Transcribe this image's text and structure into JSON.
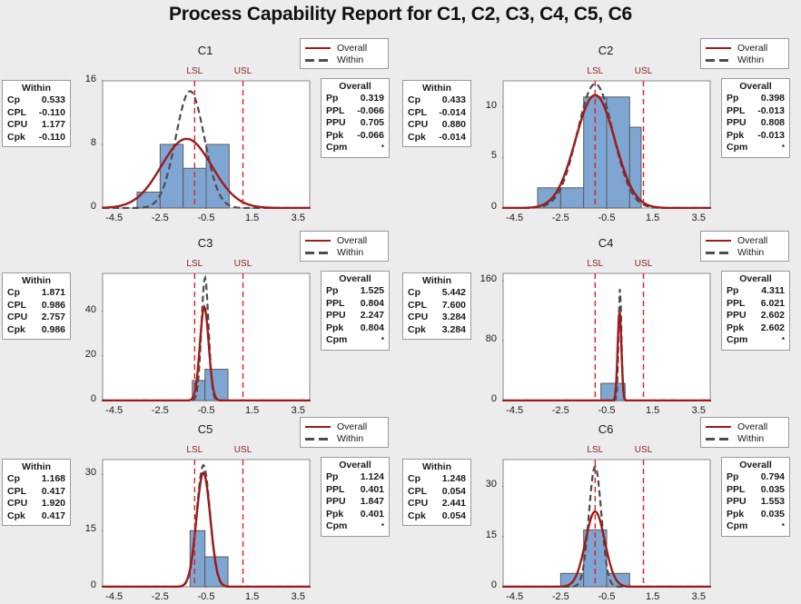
{
  "report": {
    "title": "Process Capability Report for C1, C2, C3, C4, C5, C6",
    "background_color": "#ececed",
    "bar_fill_color": "#7FA6D3",
    "bar_edge_color": "#5b5b5b",
    "overall_curve_color": "#9e1b1b",
    "within_curve_color": "#4d4d4d",
    "limit_line_color": "#e02020",
    "limit_label_color": "#8d2020"
  },
  "legend": {
    "overall_label": "Overall",
    "within_label": "Within",
    "overall_icon": "solid-line-icon",
    "within_icon": "dashed-line-icon"
  },
  "labels": {
    "lsl": "LSL",
    "usl": "USL",
    "within_header": "Within",
    "overall_header": "Overall",
    "within_keys": [
      "Cp",
      "CPL",
      "CPU",
      "Cpk"
    ],
    "overall_keys": [
      "Pp",
      "PPL",
      "PPU",
      "Ppk",
      "Cpm"
    ],
    "star": "*"
  },
  "chart_data": [
    {
      "type": "bar",
      "title": "C1",
      "xlabel": "",
      "ylabel": "",
      "xlim": [
        -5.0,
        4.0
      ],
      "ylim": [
        0,
        16
      ],
      "xticks": [
        -4.5,
        -2.5,
        -0.5,
        1.5,
        3.5
      ],
      "xticklabels": [
        "-4.5",
        "-2.5",
        "-0.5",
        "1.5",
        "3.5"
      ],
      "yticks": [
        0,
        8,
        16
      ],
      "yticklabels": [
        "0",
        "8",
        "16"
      ],
      "grid": false,
      "lsl": -1.0,
      "usl": 1.1,
      "bins": [
        {
          "left": -3.5,
          "right": -2.5,
          "count": 2
        },
        {
          "left": -2.5,
          "right": -1.5,
          "count": 8
        },
        {
          "left": -1.5,
          "right": -0.5,
          "count": 5
        },
        {
          "left": -0.5,
          "right": 0.5,
          "count": 8
        }
      ],
      "overall_curve": {
        "mean": -1.35,
        "sd": 1.1,
        "peak": 8.7
      },
      "within_curve": {
        "mean": -1.2,
        "sd": 0.62,
        "peak": 14.7
      },
      "within": {
        "Cp": "0.533",
        "CPL": "-0.110",
        "CPU": "1.177",
        "Cpk": "-0.110"
      },
      "overall": {
        "Pp": "0.319",
        "PPL": "-0.066",
        "PPU": "0.705",
        "Ppk": "-0.066",
        "Cpm": "*"
      }
    },
    {
      "type": "bar",
      "title": "C2",
      "xlabel": "",
      "ylabel": "",
      "xlim": [
        -5.0,
        4.0
      ],
      "ylim": [
        0,
        12.6
      ],
      "xticks": [
        -4.5,
        -2.5,
        -0.5,
        1.5,
        3.5
      ],
      "xticklabels": [
        "-4.5",
        "-2.5",
        "-0.5",
        "1.5",
        "3.5"
      ],
      "yticks": [
        0,
        5,
        10
      ],
      "yticklabels": [
        "0",
        "5",
        "10"
      ],
      "grid": false,
      "lsl": -1.0,
      "usl": 1.1,
      "bins": [
        {
          "left": -3.5,
          "right": -2.5,
          "count": 2
        },
        {
          "left": -2.5,
          "right": -1.5,
          "count": 2
        },
        {
          "left": -1.5,
          "right": -0.5,
          "count": 11
        },
        {
          "left": -0.5,
          "right": 0.5,
          "count": 11
        },
        {
          "left": 0.5,
          "right": 1.0,
          "count": 8
        }
      ],
      "overall_curve": {
        "mean": -1.0,
        "sd": 0.85,
        "peak": 11.2
      },
      "within_curve": {
        "mean": -1.0,
        "sd": 0.78,
        "peak": 12.3
      },
      "within": {
        "Cp": "0.433",
        "CPL": "-0.014",
        "CPU": "0.880",
        "Cpk": "-0.014"
      },
      "overall": {
        "Pp": "0.398",
        "PPL": "-0.013",
        "PPU": "0.808",
        "Ppk": "-0.013",
        "Cpm": "*"
      }
    },
    {
      "type": "bar",
      "title": "C3",
      "xlabel": "",
      "ylabel": "",
      "xlim": [
        -5.0,
        4.0
      ],
      "ylim": [
        0,
        57
      ],
      "xticks": [
        -4.5,
        -2.5,
        -0.5,
        1.5,
        3.5
      ],
      "xticklabels": [
        "-4.5",
        "-2.5",
        "-0.5",
        "1.5",
        "3.5"
      ],
      "yticks": [
        0,
        20,
        40
      ],
      "yticklabels": [
        "0",
        "20",
        "40"
      ],
      "grid": false,
      "lsl": -1.0,
      "usl": 1.1,
      "bins": [
        {
          "left": -1.1,
          "right": -0.55,
          "count": 9
        },
        {
          "left": -0.55,
          "right": 0.45,
          "count": 14
        }
      ],
      "overall_curve": {
        "mean": -0.58,
        "sd": 0.19,
        "peak": 42
      },
      "within_curve": {
        "mean": -0.55,
        "sd": 0.155,
        "peak": 55
      },
      "within": {
        "Cp": "1.871",
        "CPL": "0.986",
        "CPU": "2.757",
        "Cpk": "0.986"
      },
      "overall": {
        "Pp": "1.525",
        "PPL": "0.804",
        "PPU": "2.247",
        "Ppk": "0.804",
        "Cpm": "*"
      }
    },
    {
      "type": "bar",
      "title": "C4",
      "xlabel": "",
      "ylabel": "",
      "xlim": [
        -5.0,
        4.0
      ],
      "ylim": [
        0,
        170
      ],
      "xticks": [
        -4.5,
        -2.5,
        -0.5,
        1.5,
        3.5
      ],
      "xticklabels": [
        "-4.5",
        "-2.5",
        "-0.5",
        "1.5",
        "3.5"
      ],
      "yticks": [
        0,
        80,
        160
      ],
      "yticklabels": [
        "0",
        "80",
        "160"
      ],
      "grid": false,
      "lsl": -1.0,
      "usl": 1.1,
      "bins": [
        {
          "left": -0.75,
          "right": 0.3,
          "count": 23
        }
      ],
      "overall_curve": {
        "mean": 0.06,
        "sd": 0.08,
        "peak": 120
      },
      "within_curve": {
        "mean": 0.08,
        "sd": 0.062,
        "peak": 150
      },
      "within": {
        "Cp": "5.442",
        "CPL": "7.600",
        "CPU": "3.284",
        "Cpk": "3.284"
      },
      "overall": {
        "Pp": "4.311",
        "PPL": "6.021",
        "PPU": "2.602",
        "Ppk": "2.602",
        "Cpm": "*"
      }
    },
    {
      "type": "bar",
      "title": "C5",
      "xlabel": "",
      "ylabel": "",
      "xlim": [
        -5.0,
        4.0
      ],
      "ylim": [
        0,
        34
      ],
      "xticks": [
        -4.5,
        -2.5,
        -0.5,
        1.5,
        3.5
      ],
      "xticklabels": [
        "-4.5",
        "-2.5",
        "-0.5",
        "1.5",
        "3.5"
      ],
      "yticks": [
        0,
        15,
        30
      ],
      "yticklabels": [
        "0",
        "15",
        "30"
      ],
      "grid": false,
      "lsl": -1.0,
      "usl": 1.1,
      "bins": [
        {
          "left": -1.2,
          "right": -0.55,
          "count": 15
        },
        {
          "left": -0.55,
          "right": 0.45,
          "count": 8
        }
      ],
      "overall_curve": {
        "mean": -0.62,
        "sd": 0.3,
        "peak": 30.5
      },
      "within_curve": {
        "mean": -0.62,
        "sd": 0.29,
        "peak": 32.5
      },
      "within": {
        "Cp": "1.168",
        "CPL": "0.417",
        "CPU": "1.920",
        "Cpk": "0.417"
      },
      "overall": {
        "Pp": "1.124",
        "PPL": "0.401",
        "PPU": "1.847",
        "Ppk": "0.401",
        "Cpm": "*"
      }
    },
    {
      "type": "bar",
      "title": "C6",
      "xlabel": "",
      "ylabel": "",
      "xlim": [
        -5.0,
        4.0
      ],
      "ylim": [
        0,
        38
      ],
      "xticks": [
        -4.5,
        -2.5,
        -0.5,
        1.5,
        3.5
      ],
      "xticklabels": [
        "-4.5",
        "-2.5",
        "-0.5",
        "1.5",
        "3.5"
      ],
      "yticks": [
        0,
        15,
        30
      ],
      "yticklabels": [
        "0",
        "15",
        "30"
      ],
      "grid": false,
      "lsl": -1.0,
      "usl": 1.1,
      "bins": [
        {
          "left": -2.5,
          "right": -1.5,
          "count": 4
        },
        {
          "left": -1.5,
          "right": -0.5,
          "count": 17
        },
        {
          "left": -0.5,
          "right": 0.5,
          "count": 4
        }
      ],
      "overall_curve": {
        "mean": -1.0,
        "sd": 0.42,
        "peak": 22.5
      },
      "within_curve": {
        "mean": -1.0,
        "sd": 0.27,
        "peak": 36
      },
      "within": {
        "Cp": "1.248",
        "CPL": "0.054",
        "CPU": "2.441",
        "Cpk": "0.054"
      },
      "overall": {
        "Pp": "0.794",
        "PPL": "0.035",
        "PPU": "1.553",
        "Ppk": "0.035",
        "Cpm": "*"
      }
    }
  ]
}
